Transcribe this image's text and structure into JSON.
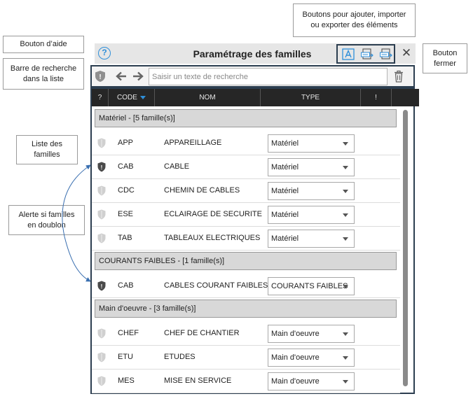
{
  "callouts": {
    "help": "Bouton d’aide",
    "search": "Barre de recherche\ndans la liste",
    "list": "Liste des\nfamilles",
    "alert": "Alerte si familles\nen doublon",
    "buttons": "Boutons  pour ajouter, importer\nou exporter des éléments",
    "close": "Bouton\nfermer"
  },
  "dialog": {
    "help_glyph": "?",
    "title": "Paramétrage des familles",
    "close_glyph": "✕"
  },
  "search": {
    "placeholder": "Saisir un texte de recherche"
  },
  "table": {
    "headers": {
      "alert": "?",
      "code": "CODE",
      "nom": "NOM",
      "type": "TYPE",
      "flag": "!"
    }
  },
  "groups": [
    {
      "label": "Matériel - [5 famille(s)]",
      "rows": [
        {
          "code": "APP",
          "nom": "APPAREILLAGE",
          "type": "Matériel",
          "duplicate": false
        },
        {
          "code": "CAB",
          "nom": "CABLE",
          "type": "Matériel",
          "duplicate": true
        },
        {
          "code": "CDC",
          "nom": "CHEMIN DE CABLES",
          "type": "Matériel",
          "duplicate": false
        },
        {
          "code": "ESE",
          "nom": "ECLAIRAGE DE SECURITE",
          "type": "Matériel",
          "duplicate": false
        },
        {
          "code": "TAB",
          "nom": "TABLEAUX ELECTRIQUES",
          "type": "Matériel",
          "duplicate": false
        }
      ]
    },
    {
      "label": "COURANTS FAIBLES - [1 famille(s)]",
      "rows": [
        {
          "code": "CAB",
          "nom": "CABLES COURANT FAIBLES",
          "type": "COURANTS FAIBLES",
          "duplicate": true
        }
      ]
    },
    {
      "label": "Main d'oeuvre - [3 famille(s)]",
      "rows": [
        {
          "code": "CHEF",
          "nom": "CHEF DE CHANTIER",
          "type": "Main d'oeuvre",
          "duplicate": false
        },
        {
          "code": "ETU",
          "nom": "ETUDES",
          "type": "Main d'oeuvre",
          "duplicate": false
        },
        {
          "code": "MES",
          "nom": "MISE EN SERVICE",
          "type": "Main d'oeuvre",
          "duplicate": false
        }
      ]
    }
  ],
  "colors": {
    "accent": "#2f8fd9",
    "header_bg": "#262626",
    "group_bg": "#d8d8d8",
    "frame": "#2c3e50",
    "shield_alert": "#4a4a4a",
    "shield_idle": "#d0d0d0"
  }
}
